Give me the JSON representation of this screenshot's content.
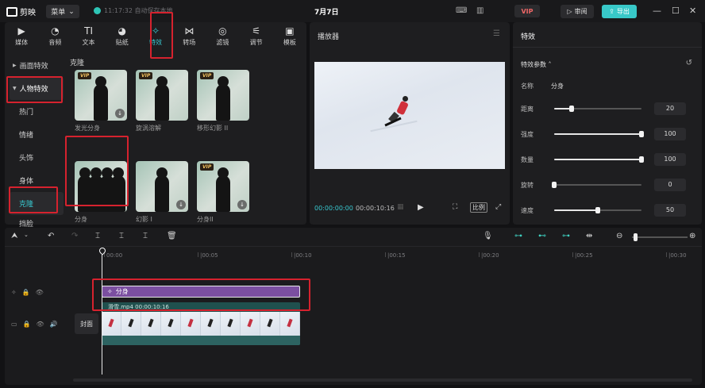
{
  "app": {
    "name": "剪映",
    "menu_label": "菜单",
    "save_status": "11:17:32 自动保存本地",
    "project_title": "7月7日",
    "vip_label": "VIP",
    "review_label": "审阅",
    "export_label": "导出"
  },
  "tabs": [
    {
      "label": "媒体",
      "icon": "media-icon",
      "glyph": "▶"
    },
    {
      "label": "音频",
      "icon": "audio-icon",
      "glyph": "◔"
    },
    {
      "label": "文本",
      "icon": "text-icon",
      "glyph": "TI"
    },
    {
      "label": "贴纸",
      "icon": "sticker-icon",
      "glyph": "◕"
    },
    {
      "label": "特效",
      "icon": "effects-icon",
      "glyph": "✧"
    },
    {
      "label": "转场",
      "icon": "transition-icon",
      "glyph": "⋈"
    },
    {
      "label": "滤镜",
      "icon": "filter-icon",
      "glyph": "◎"
    },
    {
      "label": "调节",
      "icon": "adjust-icon",
      "glyph": "⚟"
    },
    {
      "label": "模板",
      "icon": "template-icon",
      "glyph": "▣"
    }
  ],
  "subnav": {
    "screen_effects": "画面特效",
    "person_effects": "人物特效",
    "items": [
      "热门",
      "情绪",
      "头饰",
      "身体",
      "克隆",
      "挡脸"
    ]
  },
  "section_label": "克隆",
  "effects": [
    {
      "name": "发光分身",
      "vip": true,
      "download": true
    },
    {
      "name": "旋涡溶解",
      "vip": true,
      "download": false
    },
    {
      "name": "移形幻影 II",
      "vip": true,
      "download": false
    },
    {
      "name": "分身",
      "vip": false,
      "download": false
    },
    {
      "name": "幻影 I",
      "vip": false,
      "download": true
    },
    {
      "name": "分身II",
      "vip": true,
      "download": true
    },
    {
      "name": "",
      "vip": true,
      "download": false
    },
    {
      "name": "",
      "vip": true,
      "download": false
    }
  ],
  "vip_badge": "VIP",
  "player": {
    "title": "播放器",
    "current_time": "00:00:00:00",
    "total_time": "00:00:10:16",
    "ratio_label": "比例"
  },
  "props": {
    "tab": "特效",
    "params_title": "特效参数",
    "name_label": "名称",
    "name_value": "分身",
    "params": [
      {
        "label": "距离",
        "value": 20,
        "max": 100
      },
      {
        "label": "强度",
        "value": 100,
        "max": 100
      },
      {
        "label": "数量",
        "value": 100,
        "max": 100
      },
      {
        "label": "旋转",
        "value": 0,
        "max": 100
      },
      {
        "label": "速度",
        "value": 50,
        "max": 100
      }
    ]
  },
  "timeline": {
    "ruler": [
      "00:00",
      "|00:05",
      "|00:10",
      "|00:15",
      "|00:20",
      "|00:25",
      "|00:30"
    ],
    "effect_clip_label": "分身",
    "video_clip_label": "滑雪.mp4  00:00:10:16",
    "cover_label": "封面"
  }
}
